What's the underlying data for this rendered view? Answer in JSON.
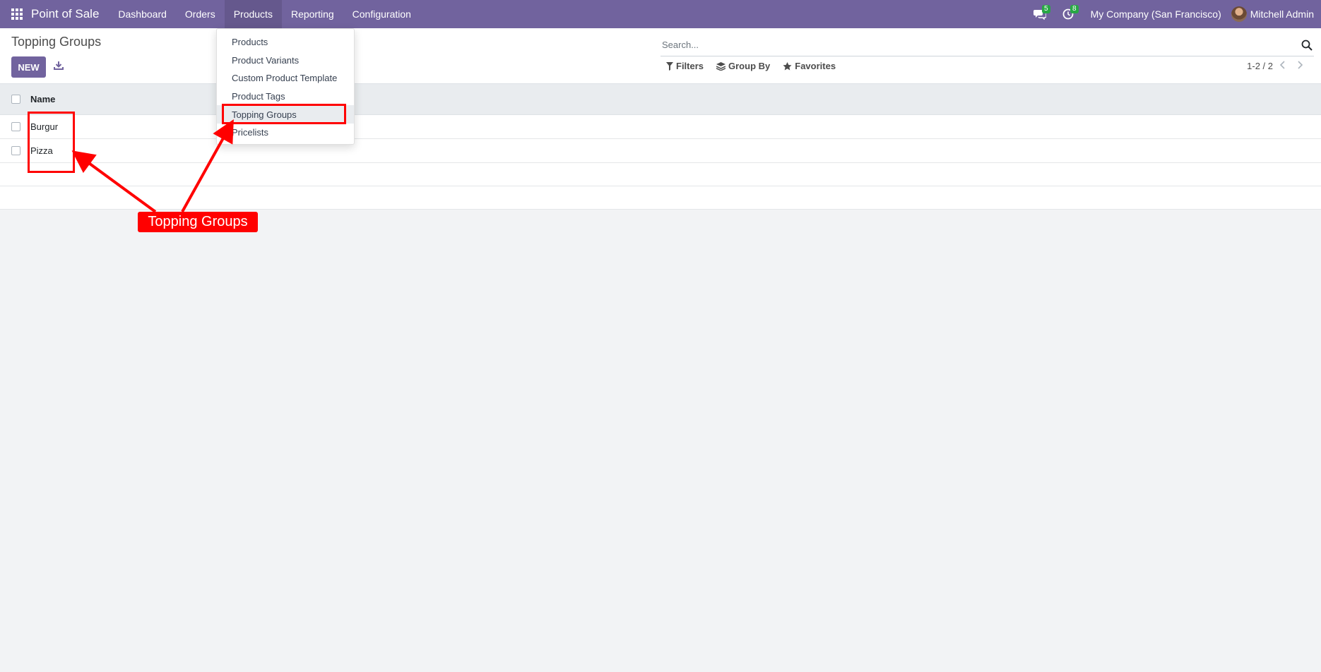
{
  "navbar": {
    "brand": "Point of Sale",
    "menu": [
      {
        "label": "Dashboard"
      },
      {
        "label": "Orders"
      },
      {
        "label": "Products"
      },
      {
        "label": "Reporting"
      },
      {
        "label": "Configuration"
      }
    ],
    "messages_count": "5",
    "activities_count": "8",
    "company": "My Company (San Francisco)",
    "user": "Mitchell Admin",
    "color": "#71639e"
  },
  "control_panel": {
    "breadcrumb": "Topping Groups",
    "new_button": "NEW",
    "search_placeholder": "Search...",
    "filters": "Filters",
    "group_by": "Group By",
    "favorites": "Favorites",
    "pager": "1-2 / 2"
  },
  "products_menu": {
    "items": [
      {
        "label": "Products"
      },
      {
        "label": "Product Variants"
      },
      {
        "label": "Custom Product Template"
      },
      {
        "label": "Product Tags"
      },
      {
        "label": "Topping Groups"
      },
      {
        "label": "Pricelists"
      }
    ]
  },
  "list": {
    "column_name": "Name",
    "rows": [
      {
        "name": "Burgur"
      },
      {
        "name": "Pizza"
      }
    ]
  },
  "annotation": {
    "label": "Topping Groups",
    "color": "#ff0000"
  }
}
